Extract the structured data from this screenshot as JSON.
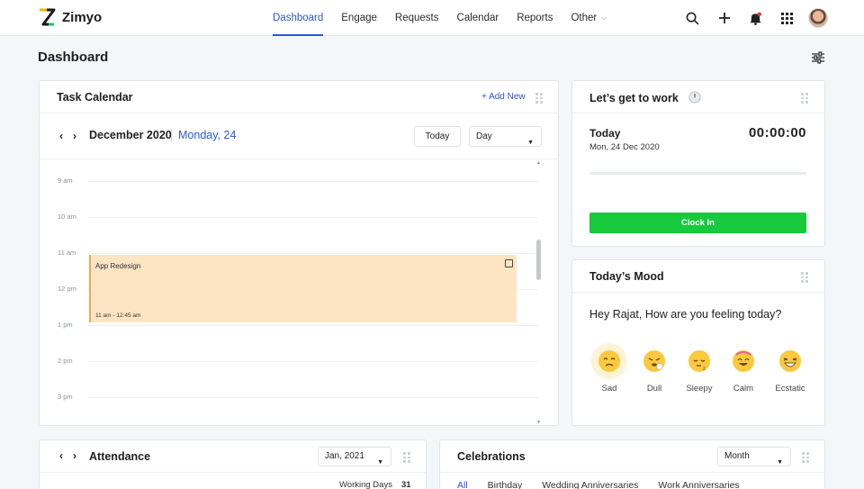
{
  "app": {
    "name": "Zimyo"
  },
  "nav": {
    "items": [
      {
        "label": "Dashboard",
        "active": true
      },
      {
        "label": "Engage"
      },
      {
        "label": "Requests"
      },
      {
        "label": "Calendar"
      },
      {
        "label": "Reports"
      },
      {
        "label": "Other",
        "dropdown": true
      }
    ]
  },
  "top_icons": [
    "search-icon",
    "add-icon",
    "bell-icon",
    "apps-grid-icon",
    "avatar"
  ],
  "page": {
    "title": "Dashboard"
  },
  "task_calendar": {
    "title": "Task Calendar",
    "add_new": "+ Add New",
    "month": "December 2020",
    "day": "Monday, 24",
    "today_button": "Today",
    "view_select": "Day",
    "time_labels": [
      "9 am",
      "10 am",
      "11 am",
      "12 pm",
      "1 pm",
      "2 pm",
      "3 pm"
    ],
    "event": {
      "title": "App Redesign",
      "time": "11 am - 12:45 am"
    }
  },
  "work": {
    "title": "Let’s get to work",
    "today_label": "Today",
    "date": "Mon, 24 Dec 2020",
    "timer": "00:00:00",
    "clock_in": "Clock In"
  },
  "mood": {
    "title": "Today’s Mood",
    "question": "Hey Rajat, How are you feeling today?",
    "options": [
      {
        "label": "Sad",
        "selected": true
      },
      {
        "label": "Dull"
      },
      {
        "label": "Sleepy"
      },
      {
        "label": "Calm"
      },
      {
        "label": "Ecstatic"
      }
    ]
  },
  "attendance": {
    "title": "Attendance",
    "month_select": "Jan, 2021",
    "working_days_label": "Working Days",
    "working_days_value": "31"
  },
  "celebrations": {
    "title": "Celebrations",
    "period_select": "Month",
    "tabs": [
      {
        "label": "All",
        "active": true
      },
      {
        "label": "Birthday"
      },
      {
        "label": "Wedding Anniversaries"
      },
      {
        "label": "Work Anniversaries"
      }
    ]
  },
  "colors": {
    "accent": "#2c56d6",
    "clock_in": "#17c93c",
    "event_bg": "#fde5c4",
    "notification": "#e53935"
  }
}
